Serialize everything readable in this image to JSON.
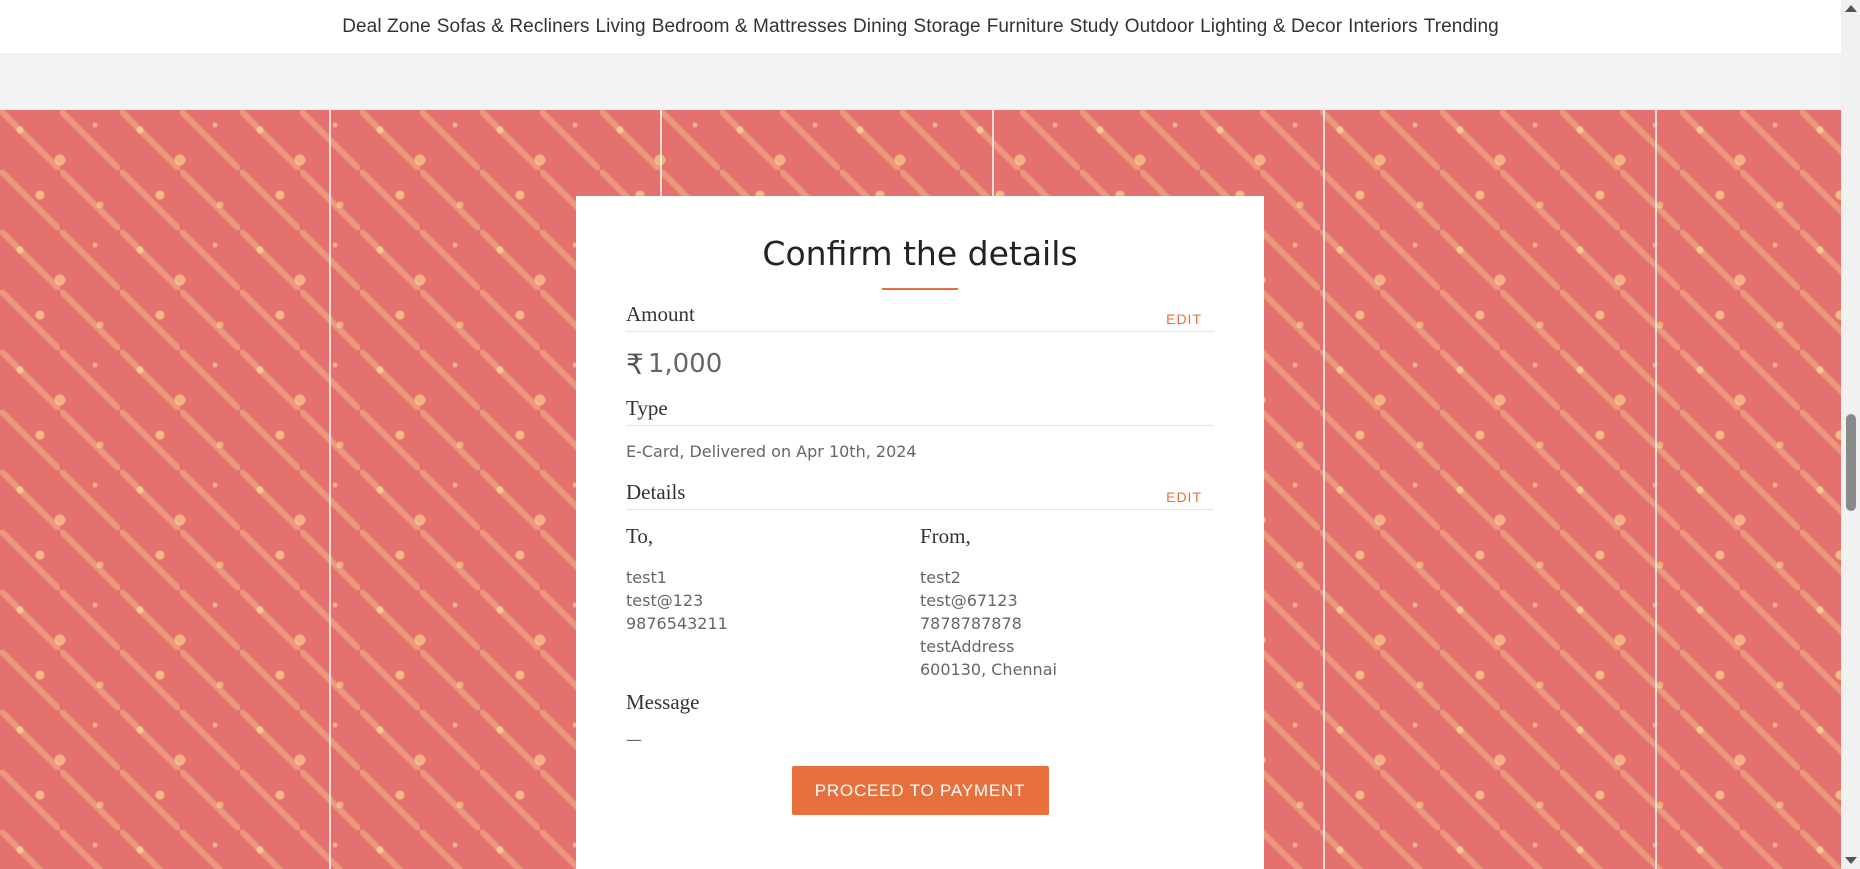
{
  "nav": {
    "items": [
      {
        "label": "Deal Zone"
      },
      {
        "label": "Sofas & Recliners"
      },
      {
        "label": "Living"
      },
      {
        "label": "Bedroom & Mattresses"
      },
      {
        "label": "Dining"
      },
      {
        "label": "Storage"
      },
      {
        "label": "Furniture"
      },
      {
        "label": "Study"
      },
      {
        "label": "Outdoor"
      },
      {
        "label": "Lighting & Decor"
      },
      {
        "label": "Interiors"
      },
      {
        "label": "Trending"
      }
    ]
  },
  "card": {
    "title": "Confirm the details",
    "amount": {
      "label": "Amount",
      "edit_label": "EDIT",
      "currency_symbol": "₹",
      "value": "1,000"
    },
    "type": {
      "label": "Type",
      "value": "E-Card, Delivered on Apr 10th, 2024"
    },
    "details": {
      "label": "Details",
      "edit_label": "EDIT",
      "to": {
        "title": "To,",
        "lines": [
          "test1",
          "test@123",
          "9876543211"
        ]
      },
      "from": {
        "title": "From,",
        "lines": [
          "test2",
          "test@67123",
          "7878787878",
          "testAddress",
          "600130, Chennai"
        ]
      }
    },
    "message": {
      "label": "Message",
      "value": "—"
    },
    "proceed_label": "PROCEED TO PAYMENT"
  },
  "colors": {
    "accent": "#e8703d",
    "pattern_bg": "#e4716e",
    "pattern_fg": "#fadf94"
  }
}
